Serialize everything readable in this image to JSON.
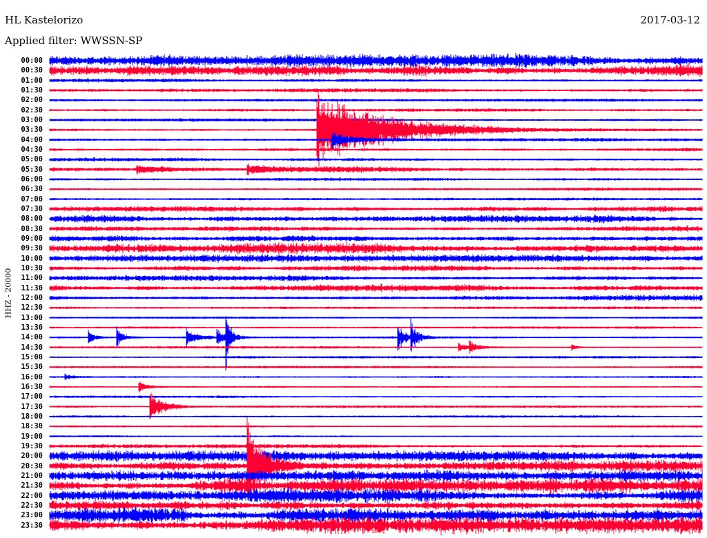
{
  "header": {
    "station": "HL Kastelorizo",
    "filter": "Applied filter: WWSSN-SP",
    "date": "2017-03-12",
    "channel": "HHZ - 20000"
  },
  "chart_data": {
    "type": "line",
    "title": "HL Kastelorizo",
    "subtitle": "Applied filter: WWSSN-SP",
    "ylabel": "HHZ - 20000",
    "minutes_per_line": 30,
    "colors": [
      "#0000ff",
      "#ff0033"
    ],
    "row_labels": [
      "00:00",
      "00:30",
      "01:00",
      "01:30",
      "02:00",
      "02:30",
      "03:00",
      "03:30",
      "04:00",
      "04:30",
      "05:00",
      "05:30",
      "06:00",
      "06:30",
      "07:00",
      "07:30",
      "08:00",
      "08:30",
      "09:00",
      "09:30",
      "10:00",
      "10:30",
      "11:00",
      "11:30",
      "12:00",
      "12:30",
      "13:00",
      "13:30",
      "14:00",
      "14:30",
      "15:00",
      "15:30",
      "16:00",
      "16:30",
      "17:00",
      "17:30",
      "18:00",
      "18:30",
      "19:00",
      "19:30",
      "20:00",
      "20:30",
      "21:00",
      "21:30",
      "22:00",
      "22:30",
      "23:00",
      "23:30"
    ],
    "noise_amplitude": [
      7,
      8,
      2,
      2,
      1.5,
      1.5,
      1.5,
      1.5,
      2,
      2,
      2,
      3,
      1.5,
      1.5,
      1.5,
      3,
      4,
      3,
      5,
      6,
      4,
      3,
      3,
      4,
      3,
      1.5,
      1,
      1,
      1,
      1,
      1,
      1,
      1,
      1,
      1,
      1,
      1,
      1,
      1,
      2,
      6,
      6,
      6,
      8,
      8,
      9,
      9,
      10
    ],
    "events": [
      {
        "row": 7,
        "minute": 12.3,
        "amplitude": 60,
        "decay": 3
      },
      {
        "row": 8,
        "minute": 13.0,
        "amplitude": 12,
        "decay": 1
      },
      {
        "row": 11,
        "minute": 4.0,
        "amplitude": 6,
        "decay": 1.5
      },
      {
        "row": 11,
        "minute": 9.1,
        "amplitude": 7,
        "decay": 1.5
      },
      {
        "row": 28,
        "minute": 1.8,
        "amplitude": 10,
        "decay": 0.3
      },
      {
        "row": 28,
        "minute": 3.1,
        "amplitude": 15,
        "decay": 0.3
      },
      {
        "row": 28,
        "minute": 6.3,
        "amplitude": 14,
        "decay": 0.4
      },
      {
        "row": 28,
        "minute": 7.7,
        "amplitude": 12,
        "decay": 0.3
      },
      {
        "row": 28,
        "minute": 8.1,
        "amplitude": 45,
        "decay": 0.2
      },
      {
        "row": 28,
        "minute": 16.0,
        "amplitude": 20,
        "decay": 0.3
      },
      {
        "row": 28,
        "minute": 16.6,
        "amplitude": 22,
        "decay": 0.3
      },
      {
        "row": 29,
        "minute": 18.8,
        "amplitude": 6,
        "decay": 0.4
      },
      {
        "row": 29,
        "minute": 19.3,
        "amplitude": 8,
        "decay": 0.4
      },
      {
        "row": 29,
        "minute": 24.0,
        "amplitude": 4,
        "decay": 0.2
      },
      {
        "row": 32,
        "minute": 0.7,
        "amplitude": 4,
        "decay": 0.5
      },
      {
        "row": 33,
        "minute": 4.1,
        "amplitude": 8,
        "decay": 0.4
      },
      {
        "row": 35,
        "minute": 4.6,
        "amplitude": 25,
        "decay": 0.6
      },
      {
        "row": 41,
        "minute": 9.1,
        "amplitude": 70,
        "decay": 0.8
      }
    ]
  }
}
